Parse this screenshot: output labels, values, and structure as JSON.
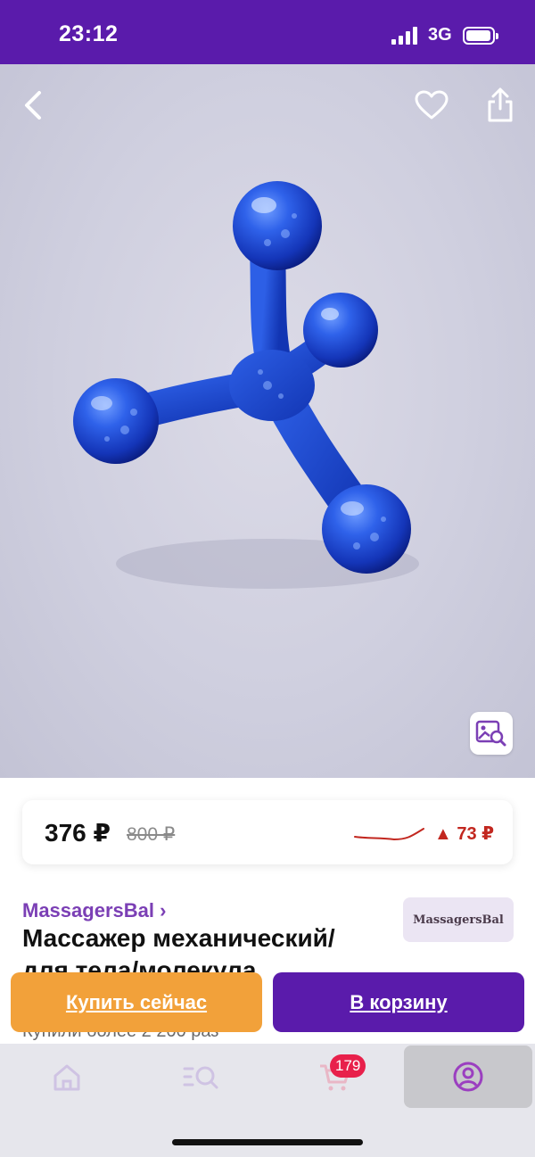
{
  "status_bar": {
    "time": "23:12",
    "network": "3G",
    "signal_bars": 4,
    "battery_level": 0.85
  },
  "hero": {
    "back_icon": "chevron-left-icon",
    "favorite_icon": "heart-icon",
    "share_icon": "share-icon",
    "image_search_icon": "image-search-icon",
    "product_color": "#1f4fd6"
  },
  "price_card": {
    "price": "376 ₽",
    "old_price": "800 ₽",
    "change": "▲ 73 ₽",
    "change_color": "#c2271f"
  },
  "seller": {
    "name": "MassagersBal ›",
    "logo_text": "MassagersBal"
  },
  "product": {
    "title": "Массажер механический/ для тела/молекула",
    "bought_text": "Купили более 2 200 раз"
  },
  "actions": {
    "buy_now": "Купить сейчас",
    "add_to_cart": "В корзину"
  },
  "bottom_nav": {
    "items": [
      "home-icon",
      "catalog-search-icon",
      "cart-icon",
      "profile-icon"
    ],
    "cart_badge": "179",
    "active_item": "profile-icon"
  },
  "colors": {
    "brand": "#5a1bab",
    "buy_now": "#f2a13a",
    "badge": "#e8204b"
  }
}
